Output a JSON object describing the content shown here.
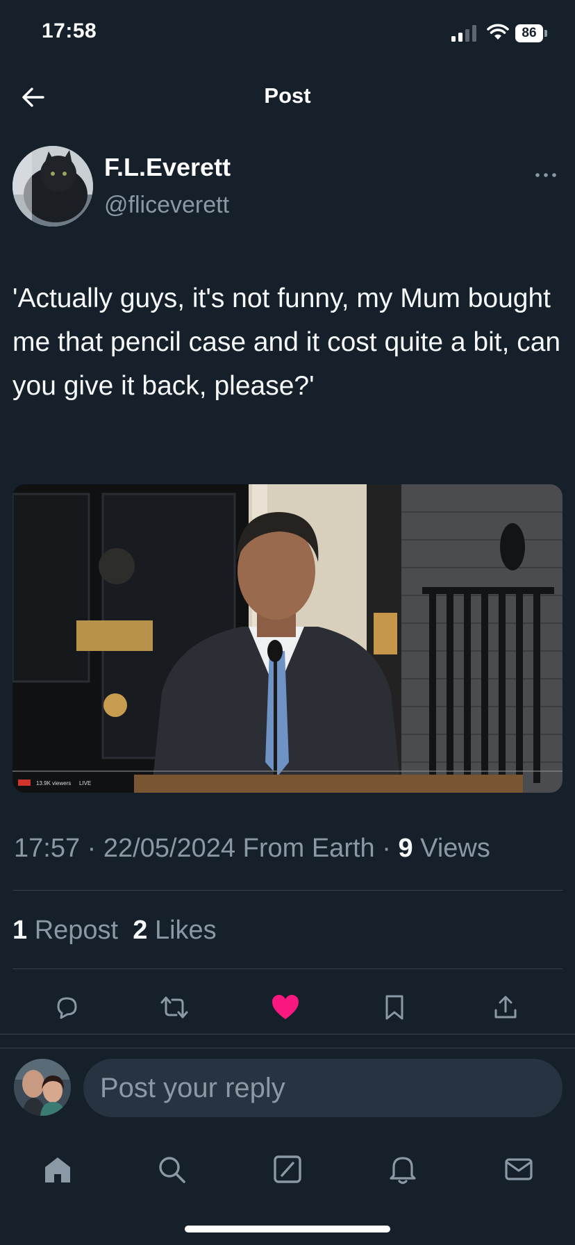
{
  "status_bar": {
    "time": "17:58",
    "battery": "86",
    "icons": [
      "signal-icon",
      "wifi-icon",
      "battery-icon"
    ]
  },
  "header": {
    "title": "Post",
    "back_icon": "arrow-left-icon"
  },
  "author": {
    "display_name": "F.L.Everett",
    "handle": "@fliceverett",
    "more_icon": "more-horizontal-icon"
  },
  "tweet": {
    "text": "'Actually guys, it's not funny, my Mum bought me that pencil case and it cost quite a bit, can you give it back, please?'"
  },
  "media": {
    "overlay_badge": "LIVE",
    "overlay_views": "13.9K viewers",
    "overlay_live": "LIVE"
  },
  "meta": {
    "time": "17:57",
    "separator": "·",
    "date": "22/05/2024",
    "source": "From Earth",
    "views_count": "9",
    "views_label": "Views"
  },
  "stats": {
    "reposts_count": "1",
    "reposts_label": "Repost",
    "likes_count": "2",
    "likes_label": "Likes"
  },
  "actions": [
    {
      "name": "reply",
      "icon": "comment-icon"
    },
    {
      "name": "repost",
      "icon": "repost-icon"
    },
    {
      "name": "like",
      "icon": "heart-icon",
      "active": true,
      "color": "#f91880"
    },
    {
      "name": "bookmark",
      "icon": "bookmark-icon"
    },
    {
      "name": "share",
      "icon": "share-icon"
    }
  ],
  "reply": {
    "placeholder": "Post your reply"
  },
  "tab_bar": [
    {
      "name": "home",
      "icon": "home-icon"
    },
    {
      "name": "search",
      "icon": "search-icon"
    },
    {
      "name": "grok",
      "icon": "grok-icon"
    },
    {
      "name": "notifications",
      "icon": "bell-icon"
    },
    {
      "name": "messages",
      "icon": "mail-icon"
    }
  ],
  "colors": {
    "background": "#15202b",
    "secondary_text": "#8b98a5",
    "divider": "#38444d",
    "like_active": "#f91880"
  }
}
